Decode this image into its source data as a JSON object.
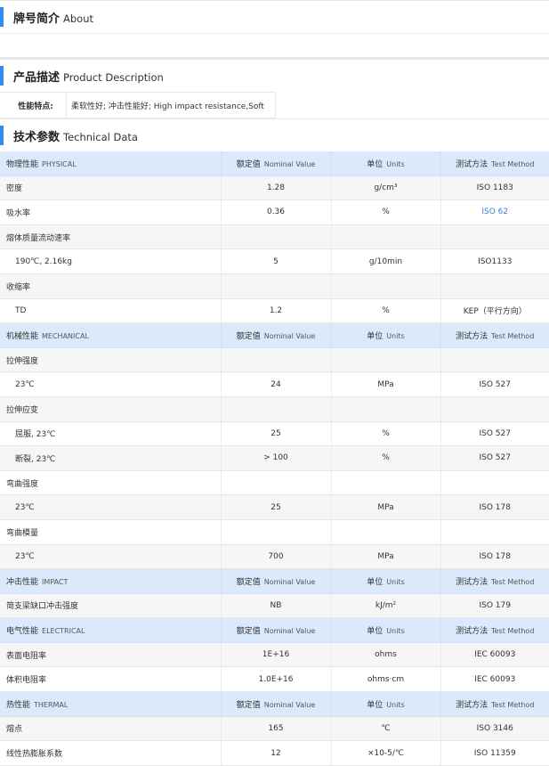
{
  "about": {
    "title_zh": "牌号简介",
    "title_en": "About"
  },
  "product": {
    "title_zh": "产品描述",
    "title_en": "Product Description",
    "features_label": "性能特点:",
    "features_value": "柔软性好; 冲击性能好;   High impact resistance,Soft"
  },
  "tech": {
    "title_zh": "技术参数",
    "title_en": "Technical Data"
  },
  "columns": {
    "nominal_zh": "额定值",
    "nominal_en": "Nominal Value",
    "units_zh": "单位",
    "units_en": "Units",
    "method_zh": "测试方法",
    "method_en": "Test Method"
  },
  "groups": [
    {
      "zh": "物理性能",
      "en": "PHYSICAL",
      "rows": [
        {
          "name": "密度",
          "value": "1.28",
          "unit": "g/cm³",
          "method": "ISO 1183"
        },
        {
          "name": "吸水率",
          "value": "0.36",
          "unit": "%",
          "method": "ISO 62",
          "method_link": true
        },
        {
          "name": "熔体质量流动速率",
          "value": "",
          "unit": "",
          "method": ""
        },
        {
          "name": "190℃, 2.16kg",
          "sub": true,
          "value": "5",
          "unit": "g/10min",
          "method": "ISO1133"
        },
        {
          "name": "收缩率",
          "value": "",
          "unit": "",
          "method": ""
        },
        {
          "name": "TD",
          "sub": true,
          "value": "1.2",
          "unit": "%",
          "method": "KEP（平行方向）"
        }
      ]
    },
    {
      "zh": "机械性能",
      "en": "MECHANICAL",
      "rows": [
        {
          "name": "拉伸强度",
          "value": "",
          "unit": "",
          "method": ""
        },
        {
          "name": "23℃",
          "sub": true,
          "value": "24",
          "unit": "MPa",
          "method": "ISO 527"
        },
        {
          "name": "拉伸应变",
          "value": "",
          "unit": "",
          "method": ""
        },
        {
          "name": "屈服, 23℃",
          "sub": true,
          "value": "25",
          "unit": "%",
          "method": "ISO 527"
        },
        {
          "name": "断裂, 23℃",
          "sub": true,
          "value": "> 100",
          "unit": "%",
          "method": "ISO 527"
        },
        {
          "name": "弯曲强度",
          "value": "",
          "unit": "",
          "method": ""
        },
        {
          "name": "23℃",
          "sub": true,
          "value": "25",
          "unit": "MPa",
          "method": "ISO 178"
        },
        {
          "name": "弯曲模量",
          "value": "",
          "unit": "",
          "method": ""
        },
        {
          "name": "23℃",
          "sub": true,
          "value": "700",
          "unit": "MPa",
          "method": "ISO 178"
        }
      ]
    },
    {
      "zh": "冲击性能",
      "en": "IMPACT",
      "rows": [
        {
          "name": "简支梁缺口冲击强度",
          "value": "NB",
          "unit": "kJ/m²",
          "method": "ISO 179"
        }
      ]
    },
    {
      "zh": "电气性能",
      "en": "ELECTRICAL",
      "rows": [
        {
          "name": "表面电阻率",
          "value": "1E+16",
          "unit": "ohms",
          "method": "IEC 60093"
        },
        {
          "name": "体积电阻率",
          "value": "1.0E+16",
          "unit": "ohms·cm",
          "method": "IEC 60093"
        }
      ]
    },
    {
      "zh": "热性能",
      "en": "THERMAL",
      "rows": [
        {
          "name": "熔点",
          "value": "165",
          "unit": "℃",
          "method": "ISO 3146"
        },
        {
          "name": "线性热膨胀系数",
          "value": "12",
          "unit": "×10-5/℃",
          "method": "ISO 11359"
        }
      ]
    }
  ]
}
